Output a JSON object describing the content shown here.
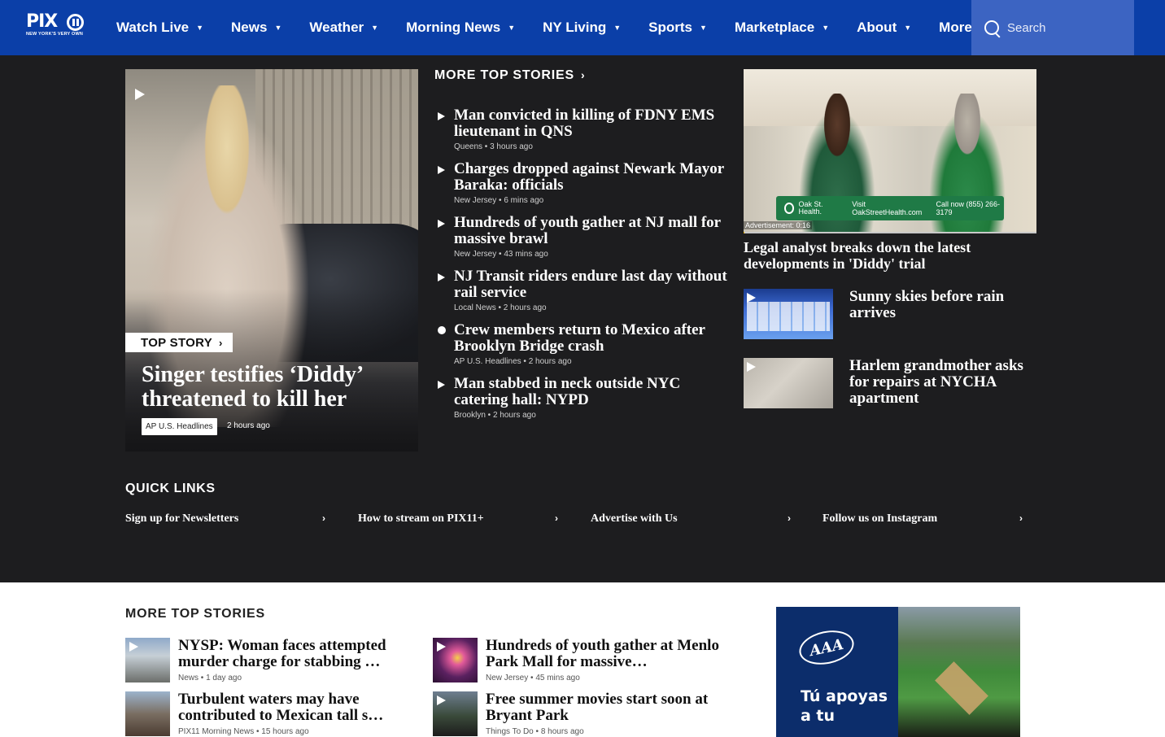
{
  "nav": {
    "logo_text": "PIX",
    "logo_tagline": "NEW YORK'S VERY OWN",
    "items": [
      {
        "label": "Watch Live"
      },
      {
        "label": "News"
      },
      {
        "label": "Weather"
      },
      {
        "label": "Morning News"
      },
      {
        "label": "NY Living"
      },
      {
        "label": "Sports"
      },
      {
        "label": "Marketplace"
      },
      {
        "label": "About"
      },
      {
        "label": "More"
      }
    ],
    "search_placeholder": "Search"
  },
  "hero": {
    "badge": "TOP STORY",
    "title": "Singer testifies ‘Diddy’ threatened to kill her",
    "tag": "AP U.S. Headlines",
    "time": "2 hours ago"
  },
  "more_top_stories": {
    "heading": "MORE TOP STORIES",
    "items": [
      {
        "title": "Man convicted in killing of FDNY EMS lieutenant in QNS",
        "category": "Queens",
        "time": "3 hours ago",
        "icon": "play"
      },
      {
        "title": "Charges dropped against Newark Mayor Baraka: officials",
        "category": "New Jersey",
        "time": "6 mins ago",
        "icon": "play"
      },
      {
        "title": "Hundreds of youth gather at NJ mall for massive brawl",
        "category": "New Jersey",
        "time": "43 mins ago",
        "icon": "play"
      },
      {
        "title": "NJ Transit riders endure last day without rail service",
        "category": "Local News",
        "time": "2 hours ago",
        "icon": "play"
      },
      {
        "title": "Crew members return to Mexico after Brooklyn Bridge crash",
        "category": "AP U.S. Headlines",
        "time": "2 hours ago",
        "icon": "dot"
      },
      {
        "title": "Man stabbed in neck outside NYC catering hall: NYPD",
        "category": "Brooklyn",
        "time": "2 hours ago",
        "icon": "play"
      }
    ]
  },
  "video": {
    "ad_label": "Advertisement: 0:16",
    "ad_brand": "Oak St. Health.",
    "ad_visit": "Visit OakStreetHealth.com",
    "ad_phone": "Call now (855) 266-3179",
    "progress": 0.003,
    "caption": "Legal analyst breaks down the latest developments in 'Diddy' trial"
  },
  "side_stories": [
    {
      "title": "Sunny skies before rain arrives"
    },
    {
      "title": "Harlem grandmother asks for repairs at NYCHA apartment"
    }
  ],
  "quick_links": {
    "heading": "QUICK LINKS",
    "items": [
      {
        "label": "Sign up for Newsletters"
      },
      {
        "label": "How to stream on PIX11+"
      },
      {
        "label": "Advertise with Us"
      },
      {
        "label": "Follow us on Instagram"
      }
    ]
  },
  "lower": {
    "heading": "MORE TOP STORIES",
    "items": [
      {
        "title": "NYSP: Woman faces attempted murder charge for stabbing …",
        "category": "News",
        "time": "1 day ago"
      },
      {
        "title": "Hundreds of youth gather at Menlo Park Mall for massive…",
        "category": "New Jersey",
        "time": "45 mins ago"
      },
      {
        "title": "Turbulent waters may have contributed to Mexican tall s…",
        "category": "PIX11 Morning News",
        "time": "15 hours ago"
      },
      {
        "title": "Free summer movies start soon at Bryant Park",
        "category": "Things To Do",
        "time": "8 hours ago"
      }
    ],
    "ad_logo": "AAA",
    "ad_text": "Tú apoyas a tu"
  },
  "colors": {
    "nav_bg": "#0b3fa8",
    "search_bg": "#3c64c2",
    "page_dark": "#1d1d1f",
    "progress_accent": "#f2b705"
  }
}
